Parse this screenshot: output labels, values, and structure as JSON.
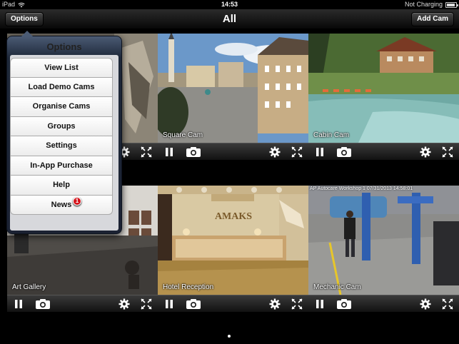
{
  "status_bar": {
    "device": "iPad",
    "time": "14:53",
    "battery_status": "Not Charging",
    "battery_level": 0.9
  },
  "nav": {
    "title": "All",
    "left_button": "Options",
    "right_button": "Add Cam"
  },
  "popover": {
    "title": "Options",
    "items": [
      {
        "label": "View List"
      },
      {
        "label": "Load Demo Cams"
      },
      {
        "label": "Organise Cams"
      },
      {
        "label": "Groups"
      },
      {
        "label": "Settings"
      },
      {
        "label": "In-App Purchase"
      },
      {
        "label": "Help"
      },
      {
        "label": "News",
        "badge": "1"
      }
    ]
  },
  "cameras": [
    {
      "name": "",
      "overlay": ""
    },
    {
      "name": "Square Cam",
      "overlay": ""
    },
    {
      "name": "Cabin Cam",
      "overlay": ""
    },
    {
      "name": "Art Gallery",
      "overlay": ""
    },
    {
      "name": "Hotel Reception",
      "overlay": ""
    },
    {
      "name": "Mechanic Cam",
      "overlay": "AP Autocare Workshop 1  07/31/2013 14:58:01"
    }
  ],
  "hotel_sign": "AMAKS",
  "icons": {
    "pause": "pause-icon",
    "snapshot": "camera-icon",
    "settings": "gear-icon",
    "fullscreen": "expand-icon",
    "wifi": "wifi-icon",
    "battery": "battery-icon"
  },
  "colors": {
    "popover_frame": "#1e2839",
    "badge": "#d4131b",
    "background": "#000000"
  }
}
